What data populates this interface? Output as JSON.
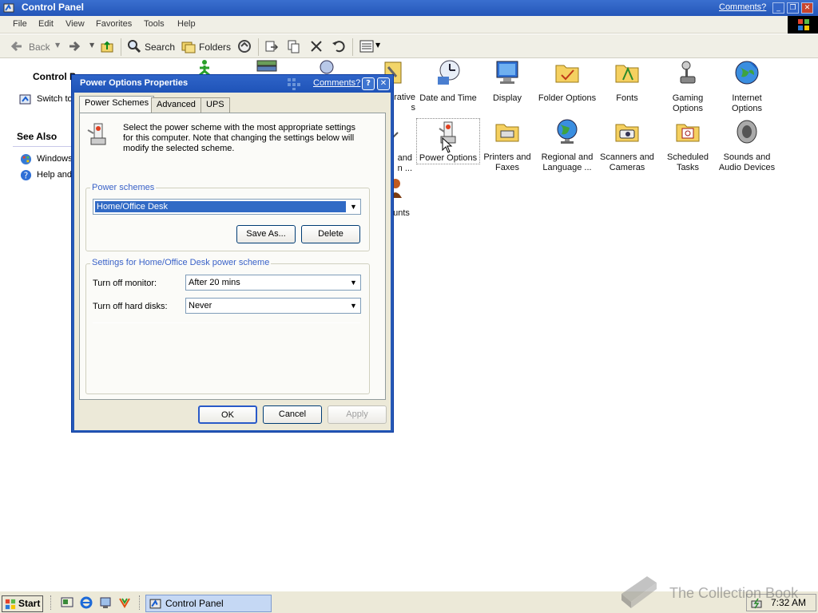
{
  "window": {
    "title": "Control Panel",
    "comments_link": "Comments?"
  },
  "menu": [
    "File",
    "Edit",
    "View",
    "Favorites",
    "Tools",
    "Help"
  ],
  "toolbar": {
    "back": "Back",
    "search": "Search",
    "folders": "Folders"
  },
  "left_pane": {
    "control_panel_heading": "Control P",
    "switch_link": "Switch to",
    "see_also": "See Also",
    "items": [
      "Windows",
      "Help and"
    ]
  },
  "items": [
    {
      "label": "rative\ns",
      "icon": "administrative-tools-icon"
    },
    {
      "label": "Date and Time",
      "icon": "clock-icon"
    },
    {
      "label": "Display",
      "icon": "monitor-icon"
    },
    {
      "label": "Folder Options",
      "icon": "folder-icon"
    },
    {
      "label": "Fonts",
      "icon": "fonts-folder-icon"
    },
    {
      "label": "Gaming\nOptions",
      "icon": "joystick-icon"
    },
    {
      "label": "Internet\nOptions",
      "icon": "globe-icon"
    },
    {
      "label": "and\nn ...",
      "icon": "partial-icon"
    },
    {
      "label": "Power Options",
      "icon": "power-options-icon"
    },
    {
      "label": "Printers and\nFaxes",
      "icon": "printer-icon"
    },
    {
      "label": "Regional and\nLanguage ...",
      "icon": "globe-icon"
    },
    {
      "label": "Scanners and\nCameras",
      "icon": "scanner-icon"
    },
    {
      "label": "Scheduled\nTasks",
      "icon": "calendar-folder-icon"
    },
    {
      "label": "Sounds and\nAudio Devices",
      "icon": "speaker-icon"
    },
    {
      "label": "ounts",
      "icon": "user-accounts-icon"
    }
  ],
  "dialog": {
    "title": "Power Options Properties",
    "comments": "Comments?",
    "help": "?",
    "tabs": [
      "Power Schemes",
      "Advanced",
      "UPS"
    ],
    "description": "Select the power scheme with the most appropriate settings for this computer. Note that changing the settings below will modify the selected scheme.",
    "schemes_group": "Power schemes",
    "scheme_value": "Home/Office Desk",
    "save_as": "Save As...",
    "delete": "Delete",
    "settings_group": "Settings for Home/Office Desk power scheme",
    "monitor_label": "Turn off monitor:",
    "monitor_value": "After 20 mins",
    "disks_label": "Turn off hard disks:",
    "disks_value": "Never",
    "ok": "OK",
    "cancel": "Cancel",
    "apply": "Apply"
  },
  "taskbar": {
    "start": "Start",
    "task": "Control Panel",
    "clock": "7:32 AM"
  },
  "watermark": "The Collection Book"
}
